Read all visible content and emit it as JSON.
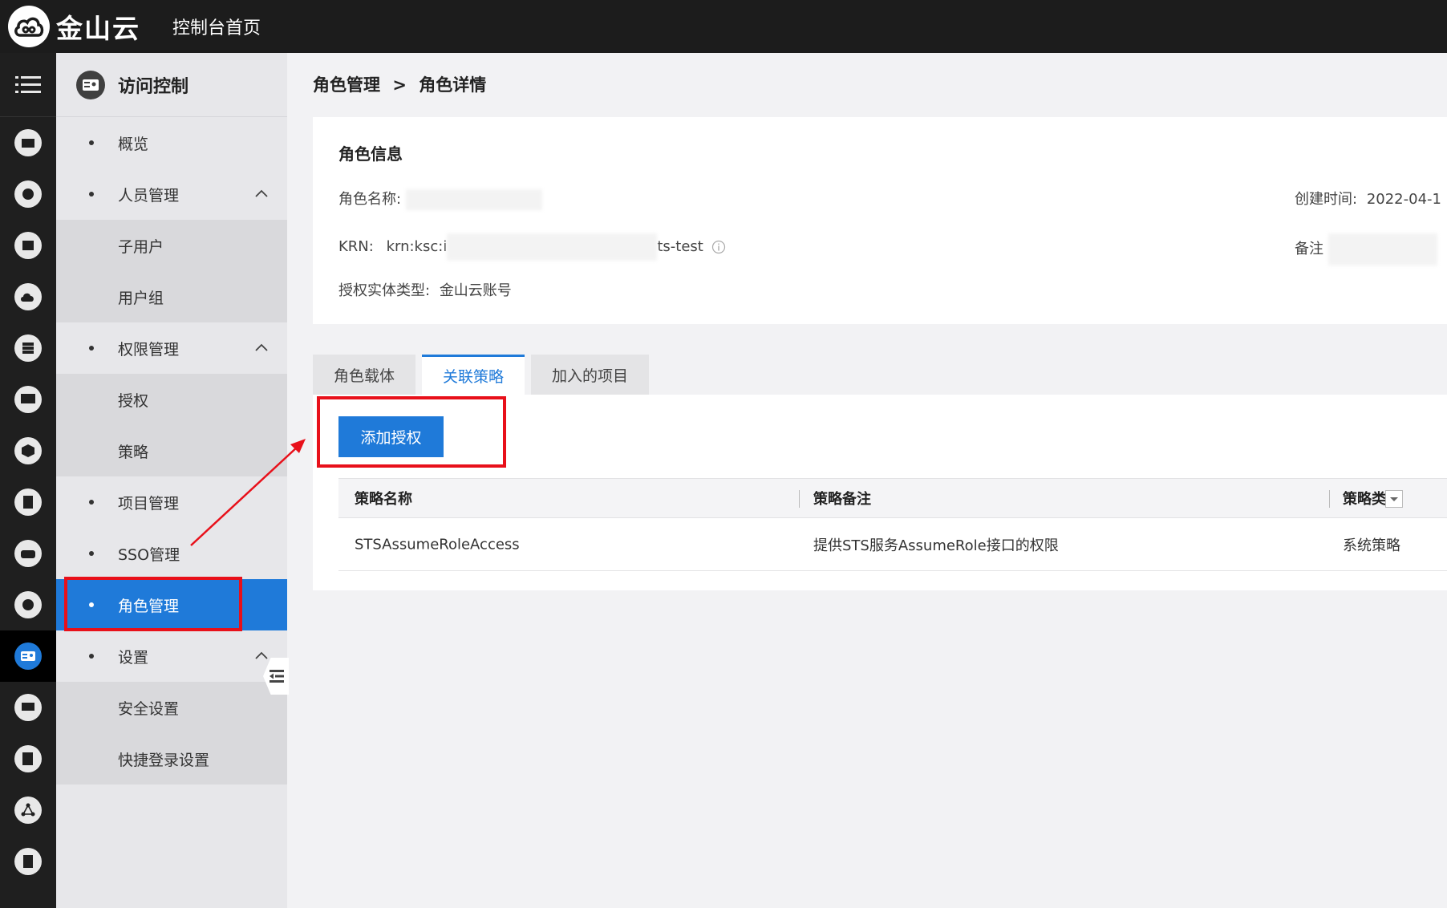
{
  "topbar": {
    "brand": "金山云",
    "console_home": "控制台首页"
  },
  "subnav": {
    "title": "访问控制",
    "items": [
      {
        "label": "概览"
      },
      {
        "label": "人员管理"
      },
      {
        "label": "子用户"
      },
      {
        "label": "用户组"
      },
      {
        "label": "权限管理"
      },
      {
        "label": "授权"
      },
      {
        "label": "策略"
      },
      {
        "label": "项目管理"
      },
      {
        "label": "SSO管理"
      },
      {
        "label": "角色管理"
      },
      {
        "label": "设置"
      },
      {
        "label": "安全设置"
      },
      {
        "label": "快捷登录设置"
      }
    ]
  },
  "breadcrumb": {
    "parent": "角色管理",
    "separator": ">",
    "current": "角色详情"
  },
  "role_info": {
    "title": "角色信息",
    "name_label": "角色名称:",
    "krn_label": "KRN:",
    "krn_prefix": "krn:ksc:i",
    "krn_suffix": "ts-test",
    "entity_label": "授权实体类型:",
    "entity_value": "金山云账号",
    "created_label": "创建时间:",
    "created_value": "2022-04-1",
    "remark_label": "备注"
  },
  "tabs": [
    {
      "label": "角色载体"
    },
    {
      "label": "关联策略"
    },
    {
      "label": "加入的项目"
    }
  ],
  "panel": {
    "add_button": "添加授权"
  },
  "table": {
    "headers": [
      "策略名称",
      "策略备注",
      "策略类型"
    ],
    "rows": [
      [
        "STSAssumeRoleAccess",
        "提供STS服务AssumeRole接口的权限",
        "系统策略"
      ]
    ]
  },
  "colors": {
    "accent": "#1f7ad9",
    "highlight": "#e8101a",
    "topbar": "#1c1c1c"
  }
}
